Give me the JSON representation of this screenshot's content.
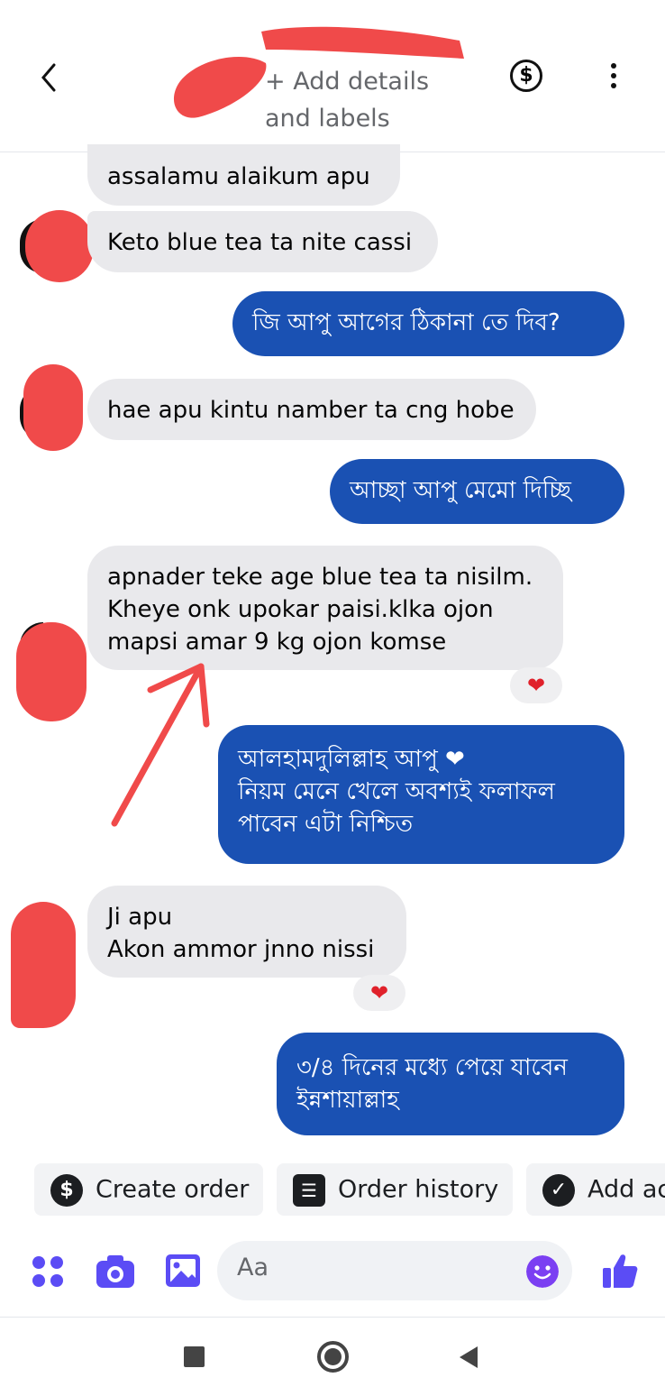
{
  "header": {
    "subtitle_line1": "+ Add details",
    "subtitle_line2": "and labels",
    "back_icon": "chevron-left-icon",
    "payment_icon": "dollar-circle-icon",
    "menu_icon": "more-vertical-icon"
  },
  "messages": [
    {
      "side": "in",
      "text": "assalamu alaikum apu"
    },
    {
      "side": "in",
      "text": "Keto blue tea ta nite cassi"
    },
    {
      "side": "out",
      "text": "জি আপু আগের ঠিকানা তে দিব?"
    },
    {
      "side": "in",
      "text": "hae apu kintu namber ta cng hobe"
    },
    {
      "side": "out",
      "text": "আচ্ছা আপু মেমো দিচ্ছি"
    },
    {
      "side": "in",
      "text": "apnader teke age blue tea ta nisilm.\nKheye onk upokar paisi.klka ojon\nmapsi amar 9 kg ojon komse",
      "reaction": "❤"
    },
    {
      "side": "out",
      "text": "আলহামদুলিল্লাহ আপু ❤\nনিয়ম মেনে খেলে অবশ্যই ফলাফল\nপাবেন এটা নিশ্চিত"
    },
    {
      "side": "in",
      "text": "Ji apu\nAkon ammor jnno nissi",
      "reaction": "❤"
    },
    {
      "side": "out",
      "text": "৩/৪ দিনের মধ্যে পেয়ে যাবেন\nইন্নশায়াল্লাহ"
    }
  ],
  "quick_actions": {
    "create_order": "Create order",
    "order_history": "Order history",
    "add_label": "Add ac"
  },
  "composer": {
    "placeholder": "Aa"
  },
  "colors": {
    "outgoing": "#1a51b3",
    "incoming": "#e9e9ec",
    "accent": "#5b4cf5",
    "redaction": "#f04a4a",
    "annotation_arrow": "#f04a4a"
  }
}
